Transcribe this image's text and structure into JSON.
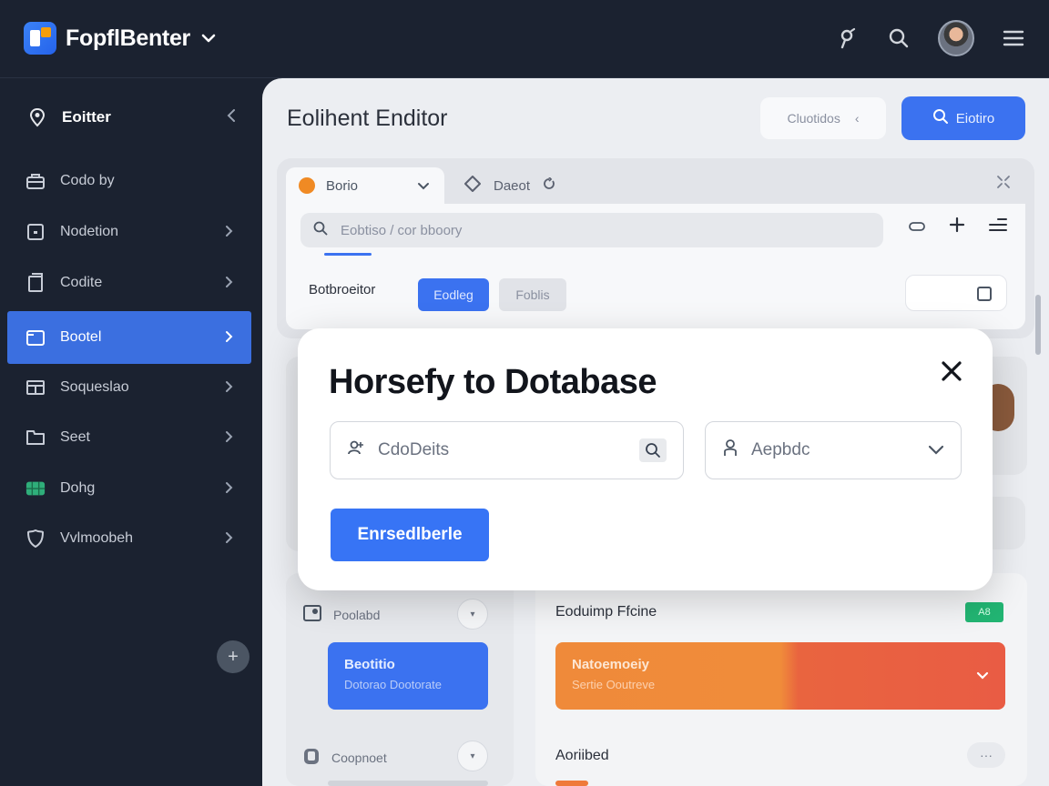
{
  "app": {
    "name": "FopflBenter"
  },
  "sidebar": {
    "header_label": "Eoitter",
    "items": [
      {
        "label": "Codo by",
        "icon": "briefcase-icon"
      },
      {
        "label": "Nodetion",
        "icon": "square-icon"
      },
      {
        "label": "Codite",
        "icon": "document-icon"
      },
      {
        "label": "Bootel",
        "icon": "folder-icon",
        "active": true
      },
      {
        "label": "Soqueslao",
        "icon": "grid-icon"
      },
      {
        "label": "Seet",
        "icon": "folder-outline-icon"
      },
      {
        "label": "Dohg",
        "icon": "table-icon"
      },
      {
        "label": "Vvlmoobeh",
        "icon": "shield-icon"
      }
    ],
    "add_label": "+"
  },
  "main": {
    "title": "Eolihent Enditor",
    "ghost_button": "Cluotidos",
    "primary_button": "Eiotiro",
    "editor": {
      "tab_active": "Borio",
      "tab_other": "Daeot",
      "search_placeholder": "Eobtiso / cor bboory",
      "filter_label": "Botbroeitor",
      "pill_a": "Eodleg",
      "pill_b": "Foblis"
    },
    "lower_left": {
      "row1": "Poolabd",
      "blue_title": "Beotitio",
      "blue_sub": "Dotorao Dootorate",
      "row2": "Coopnoet"
    },
    "lower_right": {
      "title": "Eoduimp Ffcine",
      "badge": "A8",
      "banner_title": "Natoemoeiy",
      "banner_sub": "Sertie Ooutreve",
      "subtitle": "Aoriibed",
      "more": "···"
    }
  },
  "modal": {
    "title": "Horsefy to Dotabase",
    "field1_placeholder": "CdoDeits",
    "field2_placeholder": "Aepbdc",
    "submit_button": "Enrsedlberle"
  },
  "colors": {
    "accent": "#3b72f0",
    "sidebar_bg": "#1b2230",
    "orange": "#ef8a3a",
    "success": "#22b573"
  }
}
